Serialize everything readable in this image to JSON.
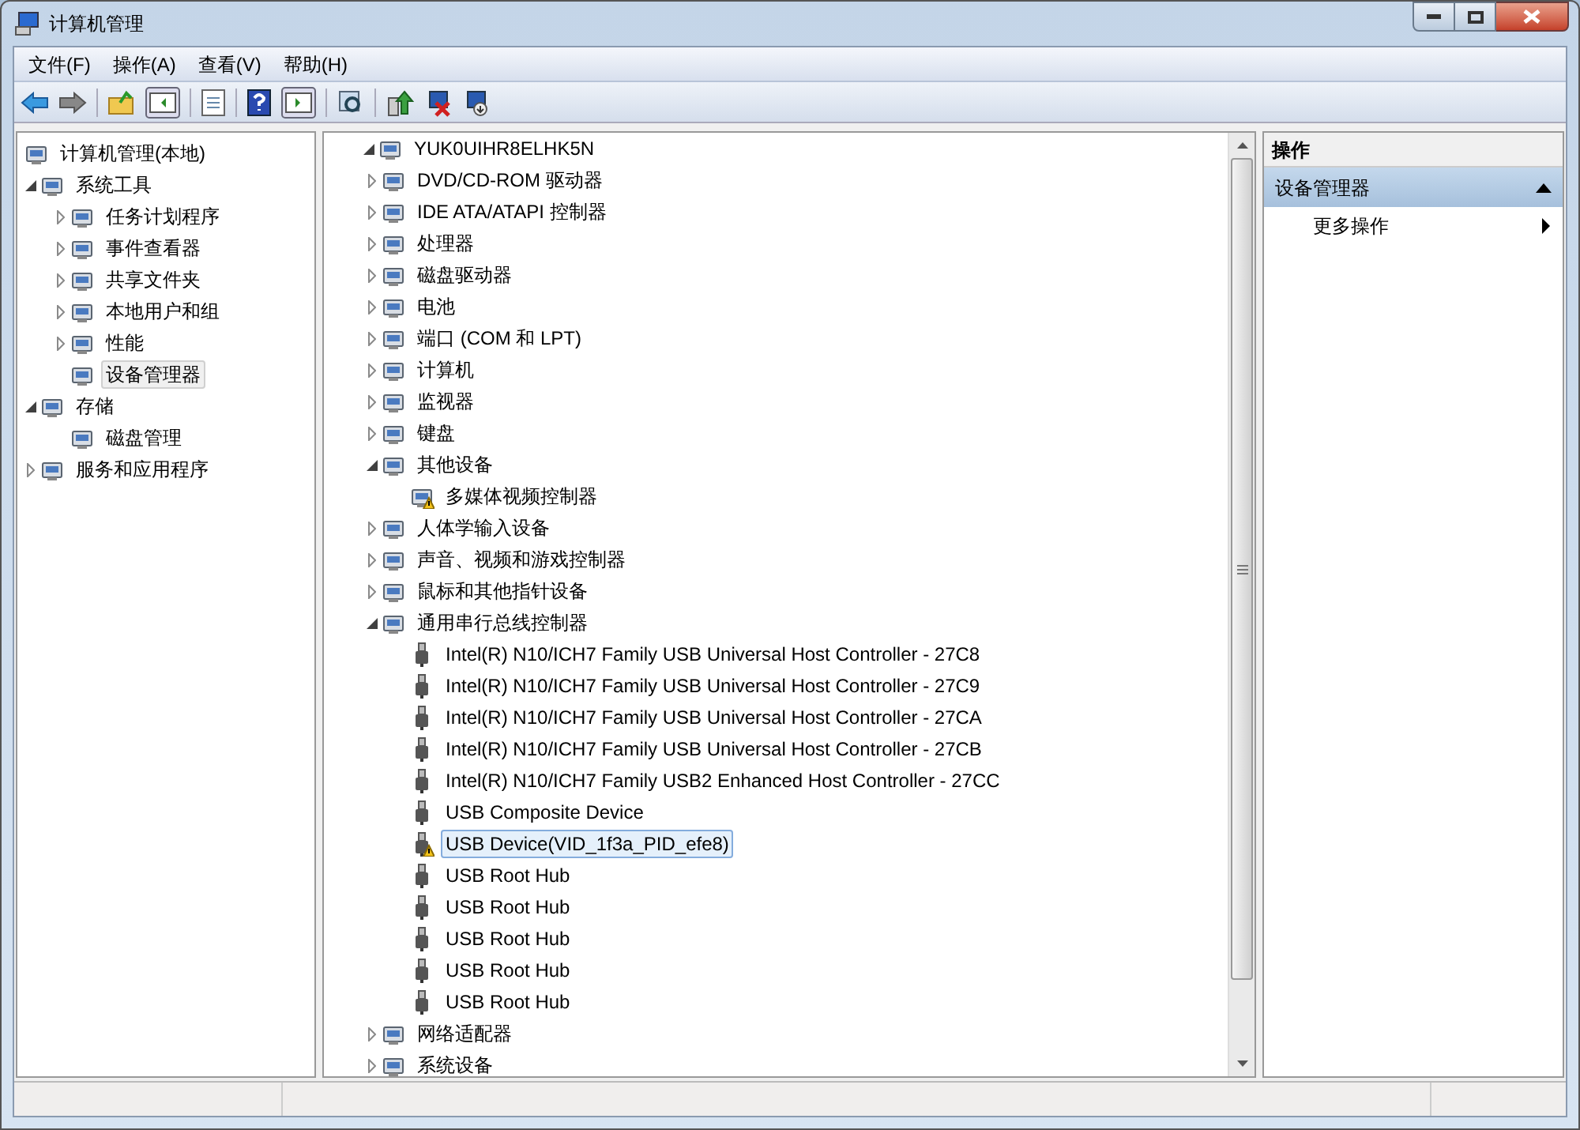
{
  "window": {
    "title": "计算机管理"
  },
  "menu": [
    "文件(F)",
    "操作(A)",
    "查看(V)",
    "帮助(H)"
  ],
  "left_tree": [
    {
      "label": "计算机管理(本地)",
      "kind": "root",
      "selected": false,
      "children": [
        {
          "label": "系统工具",
          "kind": "group",
          "expanded": true,
          "selected": false,
          "children": [
            {
              "label": "任务计划程序",
              "kind": "group",
              "expanded": false,
              "selected": false
            },
            {
              "label": "事件查看器",
              "kind": "group",
              "expanded": false,
              "selected": false
            },
            {
              "label": "共享文件夹",
              "kind": "group",
              "expanded": false,
              "selected": false
            },
            {
              "label": "本地用户和组",
              "kind": "group",
              "expanded": false,
              "selected": false
            },
            {
              "label": "性能",
              "kind": "group",
              "expanded": false,
              "selected": false
            },
            {
              "label": "设备管理器",
              "kind": "leaf",
              "selected": true
            }
          ]
        },
        {
          "label": "存储",
          "kind": "group",
          "expanded": true,
          "selected": false,
          "children": [
            {
              "label": "磁盘管理",
              "kind": "leaf",
              "selected": false
            }
          ]
        },
        {
          "label": "服务和应用程序",
          "kind": "group",
          "expanded": false,
          "selected": false
        }
      ]
    }
  ],
  "device_tree": [
    {
      "label": "YUK0UIHR8ELHK5N",
      "kind": "group",
      "expanded": true,
      "selected": false,
      "children": [
        {
          "label": "DVD/CD-ROM 驱动器",
          "kind": "group",
          "expanded": false,
          "selected": false
        },
        {
          "label": "IDE ATA/ATAPI 控制器",
          "kind": "group",
          "expanded": false,
          "selected": false
        },
        {
          "label": "处理器",
          "kind": "group",
          "expanded": false,
          "selected": false
        },
        {
          "label": "磁盘驱动器",
          "kind": "group",
          "expanded": false,
          "selected": false
        },
        {
          "label": "电池",
          "kind": "group",
          "expanded": false,
          "selected": false
        },
        {
          "label": "端口 (COM 和 LPT)",
          "kind": "group",
          "expanded": false,
          "selected": false
        },
        {
          "label": "计算机",
          "kind": "group",
          "expanded": false,
          "selected": false
        },
        {
          "label": "监视器",
          "kind": "group",
          "expanded": false,
          "selected": false
        },
        {
          "label": "键盘",
          "kind": "group",
          "expanded": false,
          "selected": false
        },
        {
          "label": "其他设备",
          "kind": "group",
          "expanded": true,
          "selected": false,
          "children": [
            {
              "label": "多媒体视频控制器",
              "kind": "leaf",
              "selected": false,
              "warning": true
            }
          ]
        },
        {
          "label": "人体学输入设备",
          "kind": "group",
          "expanded": false,
          "selected": false
        },
        {
          "label": "声音、视频和游戏控制器",
          "kind": "group",
          "expanded": false,
          "selected": false
        },
        {
          "label": "鼠标和其他指针设备",
          "kind": "group",
          "expanded": false,
          "selected": false
        },
        {
          "label": "通用串行总线控制器",
          "kind": "group",
          "expanded": true,
          "selected": false,
          "children": [
            {
              "label": "Intel(R) N10/ICH7 Family USB Universal Host Controller - 27C8",
              "kind": "usb",
              "selected": false
            },
            {
              "label": "Intel(R) N10/ICH7 Family USB Universal Host Controller - 27C9",
              "kind": "usb",
              "selected": false
            },
            {
              "label": "Intel(R) N10/ICH7 Family USB Universal Host Controller - 27CA",
              "kind": "usb",
              "selected": false
            },
            {
              "label": "Intel(R) N10/ICH7 Family USB Universal Host Controller - 27CB",
              "kind": "usb",
              "selected": false
            },
            {
              "label": "Intel(R) N10/ICH7 Family USB2 Enhanced Host Controller - 27CC",
              "kind": "usb",
              "selected": false
            },
            {
              "label": "USB Composite Device",
              "kind": "usb",
              "selected": false
            },
            {
              "label": "USB Device(VID_1f3a_PID_efe8)",
              "kind": "usb",
              "selected": true,
              "warning": true
            },
            {
              "label": "USB Root Hub",
              "kind": "usb",
              "selected": false
            },
            {
              "label": "USB Root Hub",
              "kind": "usb",
              "selected": false
            },
            {
              "label": "USB Root Hub",
              "kind": "usb",
              "selected": false
            },
            {
              "label": "USB Root Hub",
              "kind": "usb",
              "selected": false
            },
            {
              "label": "USB Root Hub",
              "kind": "usb",
              "selected": false
            }
          ]
        },
        {
          "label": "网络适配器",
          "kind": "group",
          "expanded": false,
          "selected": false
        },
        {
          "label": "系统设备",
          "kind": "group",
          "expanded": false,
          "selected": false
        }
      ]
    }
  ],
  "actions": {
    "title": "操作",
    "sections": [
      {
        "label": "设备管理器",
        "expanded": true,
        "items": [
          {
            "label": "更多操作"
          }
        ]
      }
    ]
  }
}
